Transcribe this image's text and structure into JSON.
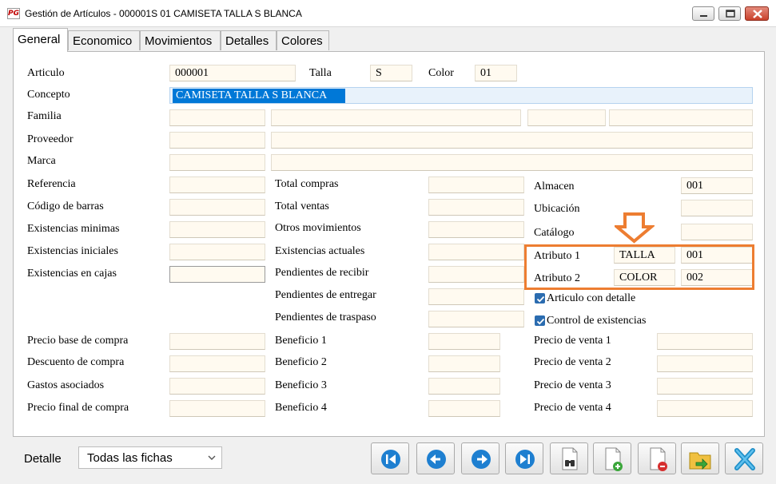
{
  "window": {
    "title": "Gestión de Artículos - 000001S 01 CAMISETA TALLA S BLANCA",
    "app_icon_text": "PG"
  },
  "tabs": [
    {
      "label": "General",
      "active": true
    },
    {
      "label": "Economico"
    },
    {
      "label": "Movimientos"
    },
    {
      "label": "Detalles"
    },
    {
      "label": "Colores"
    }
  ],
  "form": {
    "articulo_label": "Articulo",
    "articulo_value": "000001",
    "talla_label": "Talla",
    "talla_value": "S",
    "color_label": "Color",
    "color_value": "01",
    "concepto_label": "Concepto",
    "concepto_value": "CAMISETA TALLA S BLANCA",
    "familia_label": "Familia",
    "proveedor_label": "Proveedor",
    "marca_label": "Marca",
    "referencia_label": "Referencia",
    "codigo_barras_label": "Código de barras",
    "existencias_minimas_label": "Existencias minimas",
    "existencias_iniciales_label": "Existencias iniciales",
    "existencias_cajas_label": "Existencias en cajas",
    "total_compras_label": "Total compras",
    "total_ventas_label": "Total ventas",
    "otros_movimientos_label": "Otros movimientos",
    "existencias_actuales_label": "Existencias actuales",
    "pendientes_recibir_label": "Pendientes de recibir",
    "pendientes_entregar_label": "Pendientes de entregar",
    "pendientes_traspaso_label": "Pendientes de traspaso",
    "almacen_label": "Almacen",
    "almacen_value": "001",
    "ubicacion_label": "Ubicación",
    "catalogo_label": "Catálogo",
    "atributo1_label": "Atributo 1",
    "atributo1_name": "TALLA",
    "atributo1_value": "001",
    "atributo2_label": "Atributo 2",
    "atributo2_name": "COLOR",
    "atributo2_value": "002",
    "articulo_detalle_label": "Articulo con detalle",
    "articulo_detalle_checked": true,
    "control_existencias_label": "Control de existencias",
    "control_existencias_checked": true,
    "precio_base_label": "Precio base de compra",
    "descuento_label": "Descuento de compra",
    "gastos_label": "Gastos asociados",
    "precio_final_label": "Precio final de compra",
    "beneficio1_label": "Beneficio 1",
    "beneficio2_label": "Beneficio 2",
    "beneficio3_label": "Beneficio 3",
    "beneficio4_label": "Beneficio 4",
    "precio_venta1_label": "Precio de venta 1",
    "precio_venta2_label": "Precio de venta 2",
    "precio_venta3_label": "Precio de venta 3",
    "precio_venta4_label": "Precio de venta 4"
  },
  "footer": {
    "detalle_label": "Detalle",
    "detalle_value": "Todas las fichas"
  },
  "colors": {
    "highlight": "#ed7d31",
    "field_bg": "#fffaf0",
    "selection": "#0078d7",
    "nav_blue": "#1e7fd0"
  },
  "icons": [
    "app-logo-icon",
    "minimize-icon",
    "maximize-icon",
    "close-icon",
    "first-record-icon",
    "previous-record-icon",
    "next-record-icon",
    "last-record-icon",
    "search-icon",
    "new-record-icon",
    "delete-record-icon",
    "export-icon",
    "exit-icon"
  ]
}
